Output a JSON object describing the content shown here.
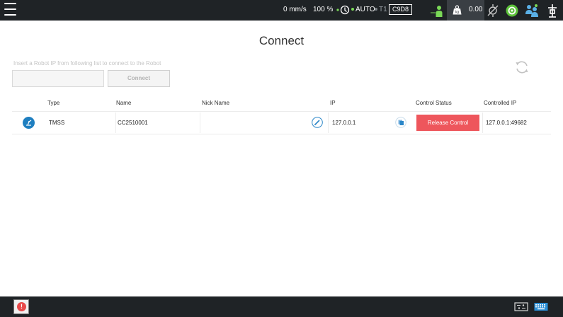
{
  "topbar": {
    "speed": "0 mm/s",
    "speed_percent": "100 %",
    "mode": "AUTO",
    "tool": "T1",
    "code": "C9D8",
    "payload": "0.00"
  },
  "page": {
    "title": "Connect"
  },
  "connect_form": {
    "hint": "Insert a Robot IP from following list to connect to the Robot",
    "ip_value": "",
    "connect_label": "Connect"
  },
  "table": {
    "headers": {
      "type": "Type",
      "name": "Name",
      "nick_name": "Nick Name",
      "ip": "IP",
      "control_status": "Control Status",
      "controlled_ip": "Controlled IP"
    },
    "rows": [
      {
        "type": "TMSS",
        "name": "CC2510001",
        "nick_name": "",
        "ip": "127.0.0.1",
        "control_action": "Release Control",
        "controlled_ip": "127.0.0.1:49682"
      }
    ]
  },
  "colors": {
    "topbar_bg": "#1f2326",
    "release_button": "#ee565c",
    "accent_blue": "#1f7fc0",
    "status_green": "#7ad957"
  },
  "icons": [
    "menu-icon",
    "servo-icon",
    "person-icon",
    "weight-icon",
    "tcp-icon",
    "status-icon",
    "users-icon",
    "robot-arm-icon",
    "refresh-icon",
    "robot-icon",
    "edit-icon",
    "copy-icon",
    "alert-icon",
    "io-icon",
    "keyboard-icon"
  ]
}
